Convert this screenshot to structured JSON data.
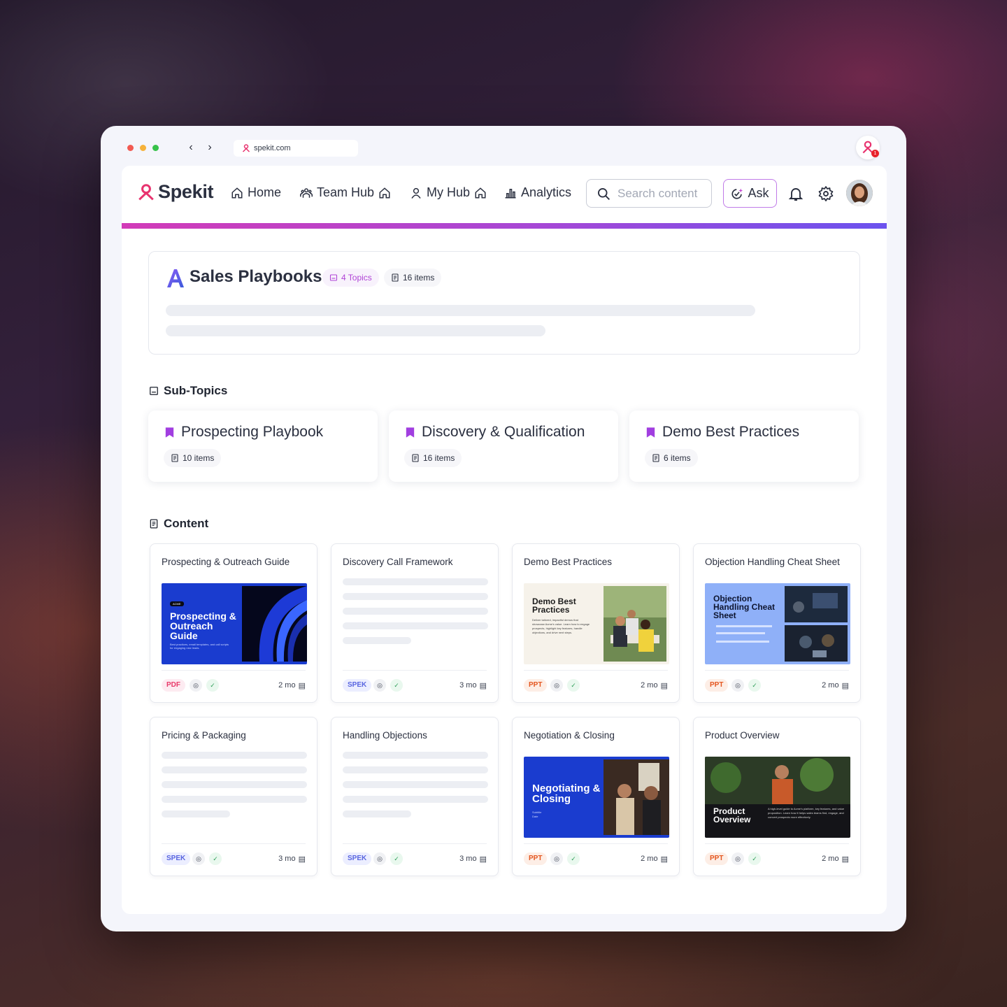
{
  "browser": {
    "url": "spekit.com",
    "extension_badge": "1"
  },
  "brand": {
    "name": "Spekit",
    "accent": "#e8336f",
    "gradient_start": "#d23bb8",
    "gradient_end": "#6b52ee"
  },
  "nav": {
    "home": "Home",
    "team_hub": "Team Hub",
    "my_hub": "My Hub",
    "analytics": "Analytics",
    "search_placeholder": "Search content",
    "ask": "Ask"
  },
  "topic": {
    "title": "Sales Playbooks",
    "topics_count": "4 Topics",
    "items_count": "16 items"
  },
  "subtopics": {
    "heading": "Sub-Topics",
    "items": [
      {
        "title": "Prospecting Playbook",
        "count": "10 items"
      },
      {
        "title": "Discovery & Qualification",
        "count": "16 items"
      },
      {
        "title": "Demo Best Practices",
        "count": "6 items"
      }
    ]
  },
  "content": {
    "heading": "Content",
    "cards": [
      {
        "title": "Prospecting & Outreach Guide",
        "type": "PDF",
        "age": "2 mo",
        "thumb": {
          "tag": "ACME",
          "heading": "Prospecting & Outreach Guide",
          "text": "Best practices, email templates, and call scripts for engaging new leads."
        }
      },
      {
        "title": "Discovery Call Framework",
        "type": "SPEK",
        "age": "3 mo"
      },
      {
        "title": "Demo Best Practices",
        "type": "PPT",
        "age": "2 mo",
        "thumb": {
          "heading": "Demo Best Practices",
          "text": "Deliver tailored, impactful demos that showcase Acme's value. Learn how to engage prospects, highlight key features, handle objections, and drive next steps."
        }
      },
      {
        "title": "Objection Handling Cheat Sheet",
        "type": "PPT",
        "age": "2 mo",
        "thumb": {
          "heading": "Objection Handling Cheat Sheet"
        }
      },
      {
        "title": "Pricing & Packaging",
        "type": "SPEK",
        "age": "3 mo"
      },
      {
        "title": "Handling Objections",
        "type": "SPEK",
        "age": "3 mo"
      },
      {
        "title": "Negotiation & Closing",
        "type": "PPT",
        "age": "2 mo",
        "thumb": {
          "heading": "Negotiating & Closing",
          "sub": "Subtitle",
          "sub2": "Date"
        }
      },
      {
        "title": "Product Overview",
        "type": "PPT",
        "age": "2 mo",
        "thumb": {
          "heading": "Product Overview",
          "text": "A high-level guide to Acme's platform, key features, and value proposition. Learn how it helps sales teams find, engage, and convert prospects more effectively."
        }
      }
    ]
  }
}
